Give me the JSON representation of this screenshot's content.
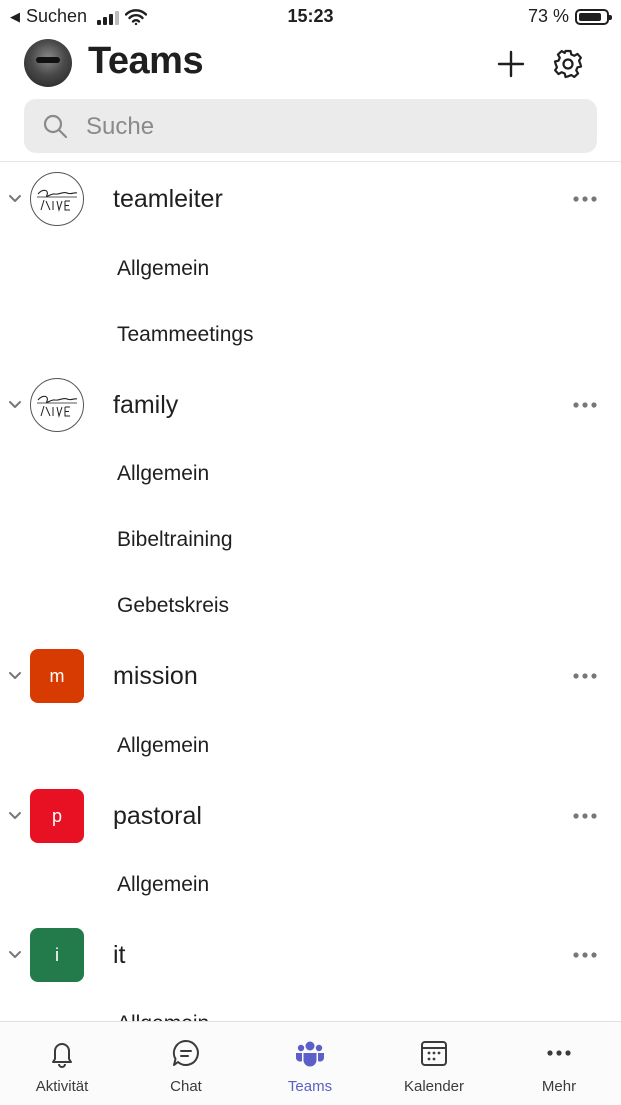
{
  "status_bar": {
    "back_label": "Suchen",
    "time": "15:23",
    "battery": "73 %"
  },
  "header": {
    "title": "Teams"
  },
  "search": {
    "placeholder": "Suche"
  },
  "teams": [
    {
      "name": "teamleiter",
      "logo_text": "",
      "logo_color": "#ffffff",
      "channels": [
        "Allgemein",
        "Teammeetings"
      ]
    },
    {
      "name": "family",
      "logo_text": "",
      "logo_color": "#ffffff",
      "channels": [
        "Allgemein",
        "Bibeltraining",
        "Gebetskreis"
      ]
    },
    {
      "name": "mission",
      "logo_text": "m",
      "logo_color": "#d83b01",
      "channels": [
        "Allgemein"
      ]
    },
    {
      "name": "pastoral",
      "logo_text": "p",
      "logo_color": "#e81123",
      "channels": [
        "Allgemein"
      ]
    },
    {
      "name": "it",
      "logo_text": "i",
      "logo_color": "#237b4b",
      "channels": [
        "Allgemein"
      ]
    }
  ],
  "tabbar": [
    {
      "label": "Aktivität",
      "icon": "bell-icon"
    },
    {
      "label": "Chat",
      "icon": "chat-icon"
    },
    {
      "label": "Teams",
      "icon": "teams-icon",
      "active": true
    },
    {
      "label": "Kalender",
      "icon": "calendar-icon"
    },
    {
      "label": "Mehr",
      "icon": "more-icon"
    }
  ],
  "colors": {
    "accent": "#5b5fc7"
  }
}
